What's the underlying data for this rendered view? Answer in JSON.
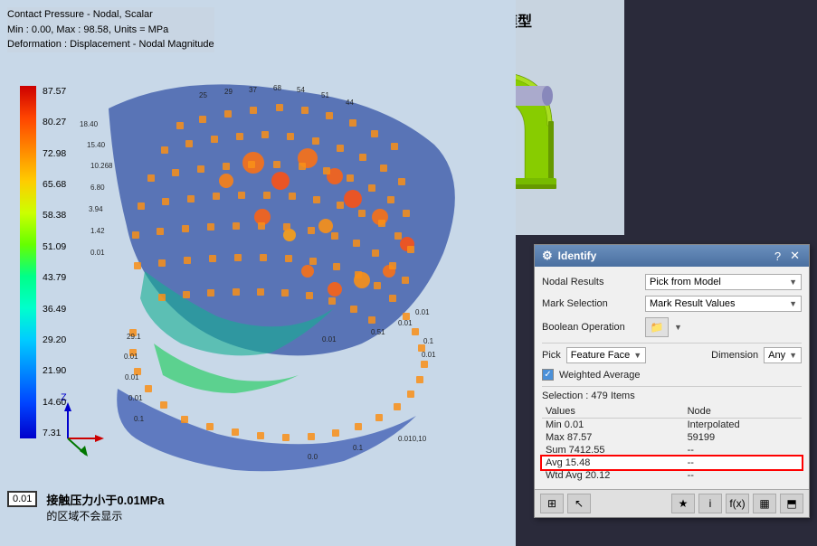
{
  "info": {
    "line1": "Contact Pressure - Nodal, Scalar",
    "line2": "Min : 0.00, Max : 98.58, Units = MPa",
    "line3": "Deformation : Displacement - Nodal Magnitude"
  },
  "legend": {
    "values": [
      "87.57",
      "80.27",
      "72.98",
      "65.68",
      "58.38",
      "51.09",
      "43.79",
      "36.49",
      "29.20",
      "21.90",
      "14.60",
      "7.31"
    ]
  },
  "model": {
    "title": "带开口的模型"
  },
  "panel": {
    "title": "Identify",
    "nodal_results_label": "Nodal Results",
    "nodal_results_value": "Pick from Model",
    "mark_selection_label": "Mark Selection",
    "mark_selection_value": "Mark Result Values",
    "boolean_operation_label": "Boolean Operation",
    "pick_label": "Pick",
    "pick_value": "Feature Face",
    "dimension_label": "Dimension",
    "dimension_value": "Any",
    "weighted_avg_label": "Weighted Average",
    "selection_info": "Selection : 479 Items",
    "table_headers": [
      "Values",
      "Node"
    ],
    "table_rows": [
      [
        "Min 0.01",
        "Interpolated"
      ],
      [
        "Max 87.57",
        "59199"
      ],
      [
        "Sum 7412.55",
        "--"
      ],
      [
        "Avg 15.48",
        "--"
      ],
      [
        "Wtd Avg 20.12",
        "--"
      ]
    ],
    "avg_row_index": 3,
    "footer_icons": [
      "grid-icon",
      "cursor-icon",
      "star-icon",
      "info-icon",
      "fx-icon",
      "table-icon",
      "export-icon"
    ]
  },
  "bottom_legend": {
    "box_value": "0.01",
    "text_line1": "接触压力小于0.01MPa",
    "text_line2": "的区域不会显示"
  }
}
